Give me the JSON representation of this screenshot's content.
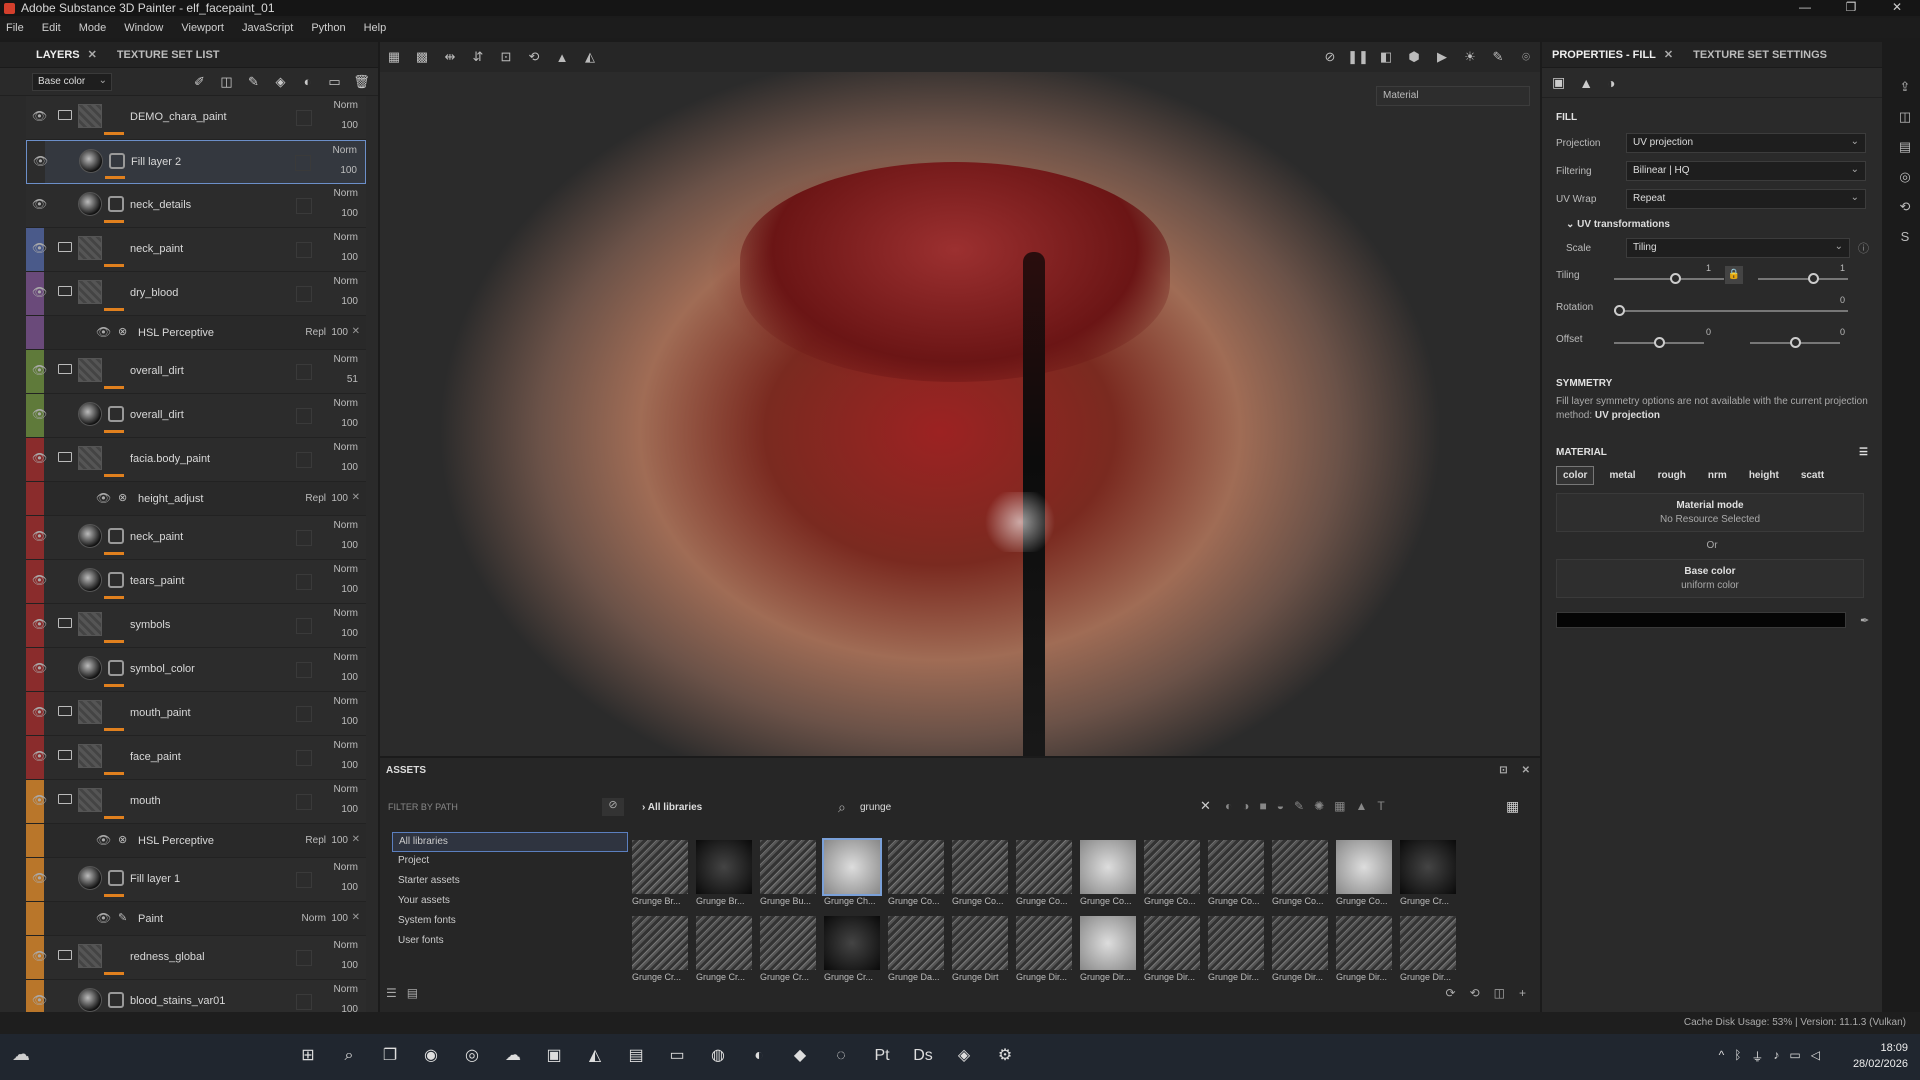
{
  "window": {
    "title": "Adobe Substance 3D Painter - elf_facepaint_01",
    "controls": [
      "—",
      "❐",
      "✕"
    ]
  },
  "menu": [
    "File",
    "Edit",
    "Mode",
    "Window",
    "Viewport",
    "JavaScript",
    "Python",
    "Help"
  ],
  "layers_panel": {
    "tabs": [
      "LAYERS",
      "TEXTURE SET LIST"
    ],
    "channel": "Base color",
    "layers": [
      {
        "name": "DEMO_chara_paint",
        "blend": "Norm",
        "opacity": "100",
        "type": "folder",
        "tag": "#2c2c2c"
      },
      {
        "name": "Fill layer 2",
        "blend": "Norm",
        "opacity": "100",
        "type": "fill",
        "tag": "#2c2c2c",
        "selected": true
      },
      {
        "name": "neck_details",
        "blend": "Norm",
        "opacity": "100",
        "type": "fill",
        "tag": "#2c2c2c"
      },
      {
        "name": "neck_paint",
        "blend": "Norm",
        "opacity": "100",
        "type": "folder",
        "tag": "#4a5a8a"
      },
      {
        "name": "dry_blood",
        "blend": "Norm",
        "opacity": "100",
        "type": "folder",
        "tag": "#6a4a7a"
      },
      {
        "name": "HSL Perceptive",
        "blend": "Repl",
        "opacity": "100",
        "type": "filter",
        "tag": "#6a4a7a"
      },
      {
        "name": "overall_dirt",
        "blend": "Norm",
        "opacity": "51",
        "type": "folder",
        "tag": "#5f7a3a"
      },
      {
        "name": "overall_dirt",
        "blend": "Norm",
        "opacity": "100",
        "type": "fill",
        "tag": "#5f7a3a"
      },
      {
        "name": "facia.body_paint",
        "blend": "Norm",
        "opacity": "100",
        "type": "folder",
        "tag": "#8a2c2c"
      },
      {
        "name": "height_adjust",
        "blend": "Repl",
        "opacity": "100",
        "type": "filter",
        "tag": "#8a2c2c"
      },
      {
        "name": "neck_paint",
        "blend": "Norm",
        "opacity": "100",
        "type": "fill",
        "tag": "#8a2c2c"
      },
      {
        "name": "tears_paint",
        "blend": "Norm",
        "opacity": "100",
        "type": "fill",
        "tag": "#8a2c2c"
      },
      {
        "name": "symbols",
        "blend": "Norm",
        "opacity": "100",
        "type": "folder",
        "tag": "#8a2c2c"
      },
      {
        "name": "symbol_color",
        "blend": "Norm",
        "opacity": "100",
        "type": "fill",
        "tag": "#8a2c2c"
      },
      {
        "name": "mouth_paint",
        "blend": "Norm",
        "opacity": "100",
        "type": "folder",
        "tag": "#8a2c2c"
      },
      {
        "name": "face_paint",
        "blend": "Norm",
        "opacity": "100",
        "type": "folder",
        "tag": "#8a2c2c"
      },
      {
        "name": "mouth",
        "blend": "Norm",
        "opacity": "100",
        "type": "folder",
        "tag": "#b9762a"
      },
      {
        "name": "HSL Perceptive",
        "blend": "Repl",
        "opacity": "100",
        "type": "filter",
        "tag": "#b9762a"
      },
      {
        "name": "Fill layer 1",
        "blend": "Norm",
        "opacity": "100",
        "type": "fill",
        "tag": "#b9762a"
      },
      {
        "name": "Paint",
        "blend": "Norm",
        "opacity": "100",
        "type": "paint",
        "tag": "#b9762a"
      },
      {
        "name": "redness_global",
        "blend": "Norm",
        "opacity": "100",
        "type": "folder",
        "tag": "#b9762a"
      },
      {
        "name": "blood_stains_var01",
        "blend": "Norm",
        "opacity": "100",
        "type": "fill",
        "tag": "#b9762a"
      }
    ]
  },
  "viewport": {
    "material_mode": "Material"
  },
  "properties": {
    "tabs": [
      "PROPERTIES - FILL",
      "TEXTURE SET SETTINGS"
    ],
    "fill_title": "FILL",
    "projection_label": "Projection",
    "projection": "UV projection",
    "filtering_label": "Filtering",
    "filtering": "Bilinear | HQ",
    "uvwrap_label": "UV Wrap",
    "uvwrap": "Repeat",
    "uv_transform_title": "UV transformations",
    "scale_label": "Scale",
    "scale": "Tiling",
    "tiling_label": "Tiling",
    "tiling_value": "1",
    "tiling_value2": "1",
    "rotation_label": "Rotation",
    "rotation_value": "0",
    "offset_label": "Offset",
    "offset_u": "0",
    "offset_v": "0",
    "symmetry_title": "SYMMETRY",
    "symmetry_text": "Fill layer symmetry options are not available with the current projection method:",
    "symmetry_method": "UV projection",
    "material_title": "MATERIAL",
    "material_channels": [
      "color",
      "metal",
      "rough",
      "nrm",
      "height",
      "scatt"
    ],
    "material_mode_title": "Material mode",
    "material_mode_sub": "No Resource Selected",
    "or": "Or",
    "base_color_title": "Base color",
    "base_color_sub": "uniform color"
  },
  "assets": {
    "title": "ASSETS",
    "filter_label": "FILTER BY PATH",
    "libraries": [
      "All libraries",
      "Project",
      "Starter assets",
      "Your assets",
      "System fonts",
      "User fonts"
    ],
    "breadcrumb": "All libraries",
    "search": "grunge",
    "items": [
      "Grunge Br...",
      "Grunge Br...",
      "Grunge Bu...",
      "Grunge Ch...",
      "Grunge Co...",
      "Grunge Co...",
      "Grunge Co...",
      "Grunge Co...",
      "Grunge Co...",
      "Grunge Co...",
      "Grunge Co...",
      "Grunge Co...",
      "Grunge Cr...",
      "Grunge Cr...",
      "Grunge Cr...",
      "Grunge Cr...",
      "Grunge Cr...",
      "Grunge Da...",
      "Grunge Dirt",
      "Grunge Dir...",
      "Grunge Dir...",
      "Grunge Dir...",
      "Grunge Dir...",
      "Grunge Dir...",
      "Grunge Dir...",
      "Grunge Dir..."
    ]
  },
  "status": "Cache Disk Usage:   53% | Version: 11.1.3 (Vulkan)",
  "taskbar": {
    "time": "18:09",
    "date": "28/02/2026"
  }
}
